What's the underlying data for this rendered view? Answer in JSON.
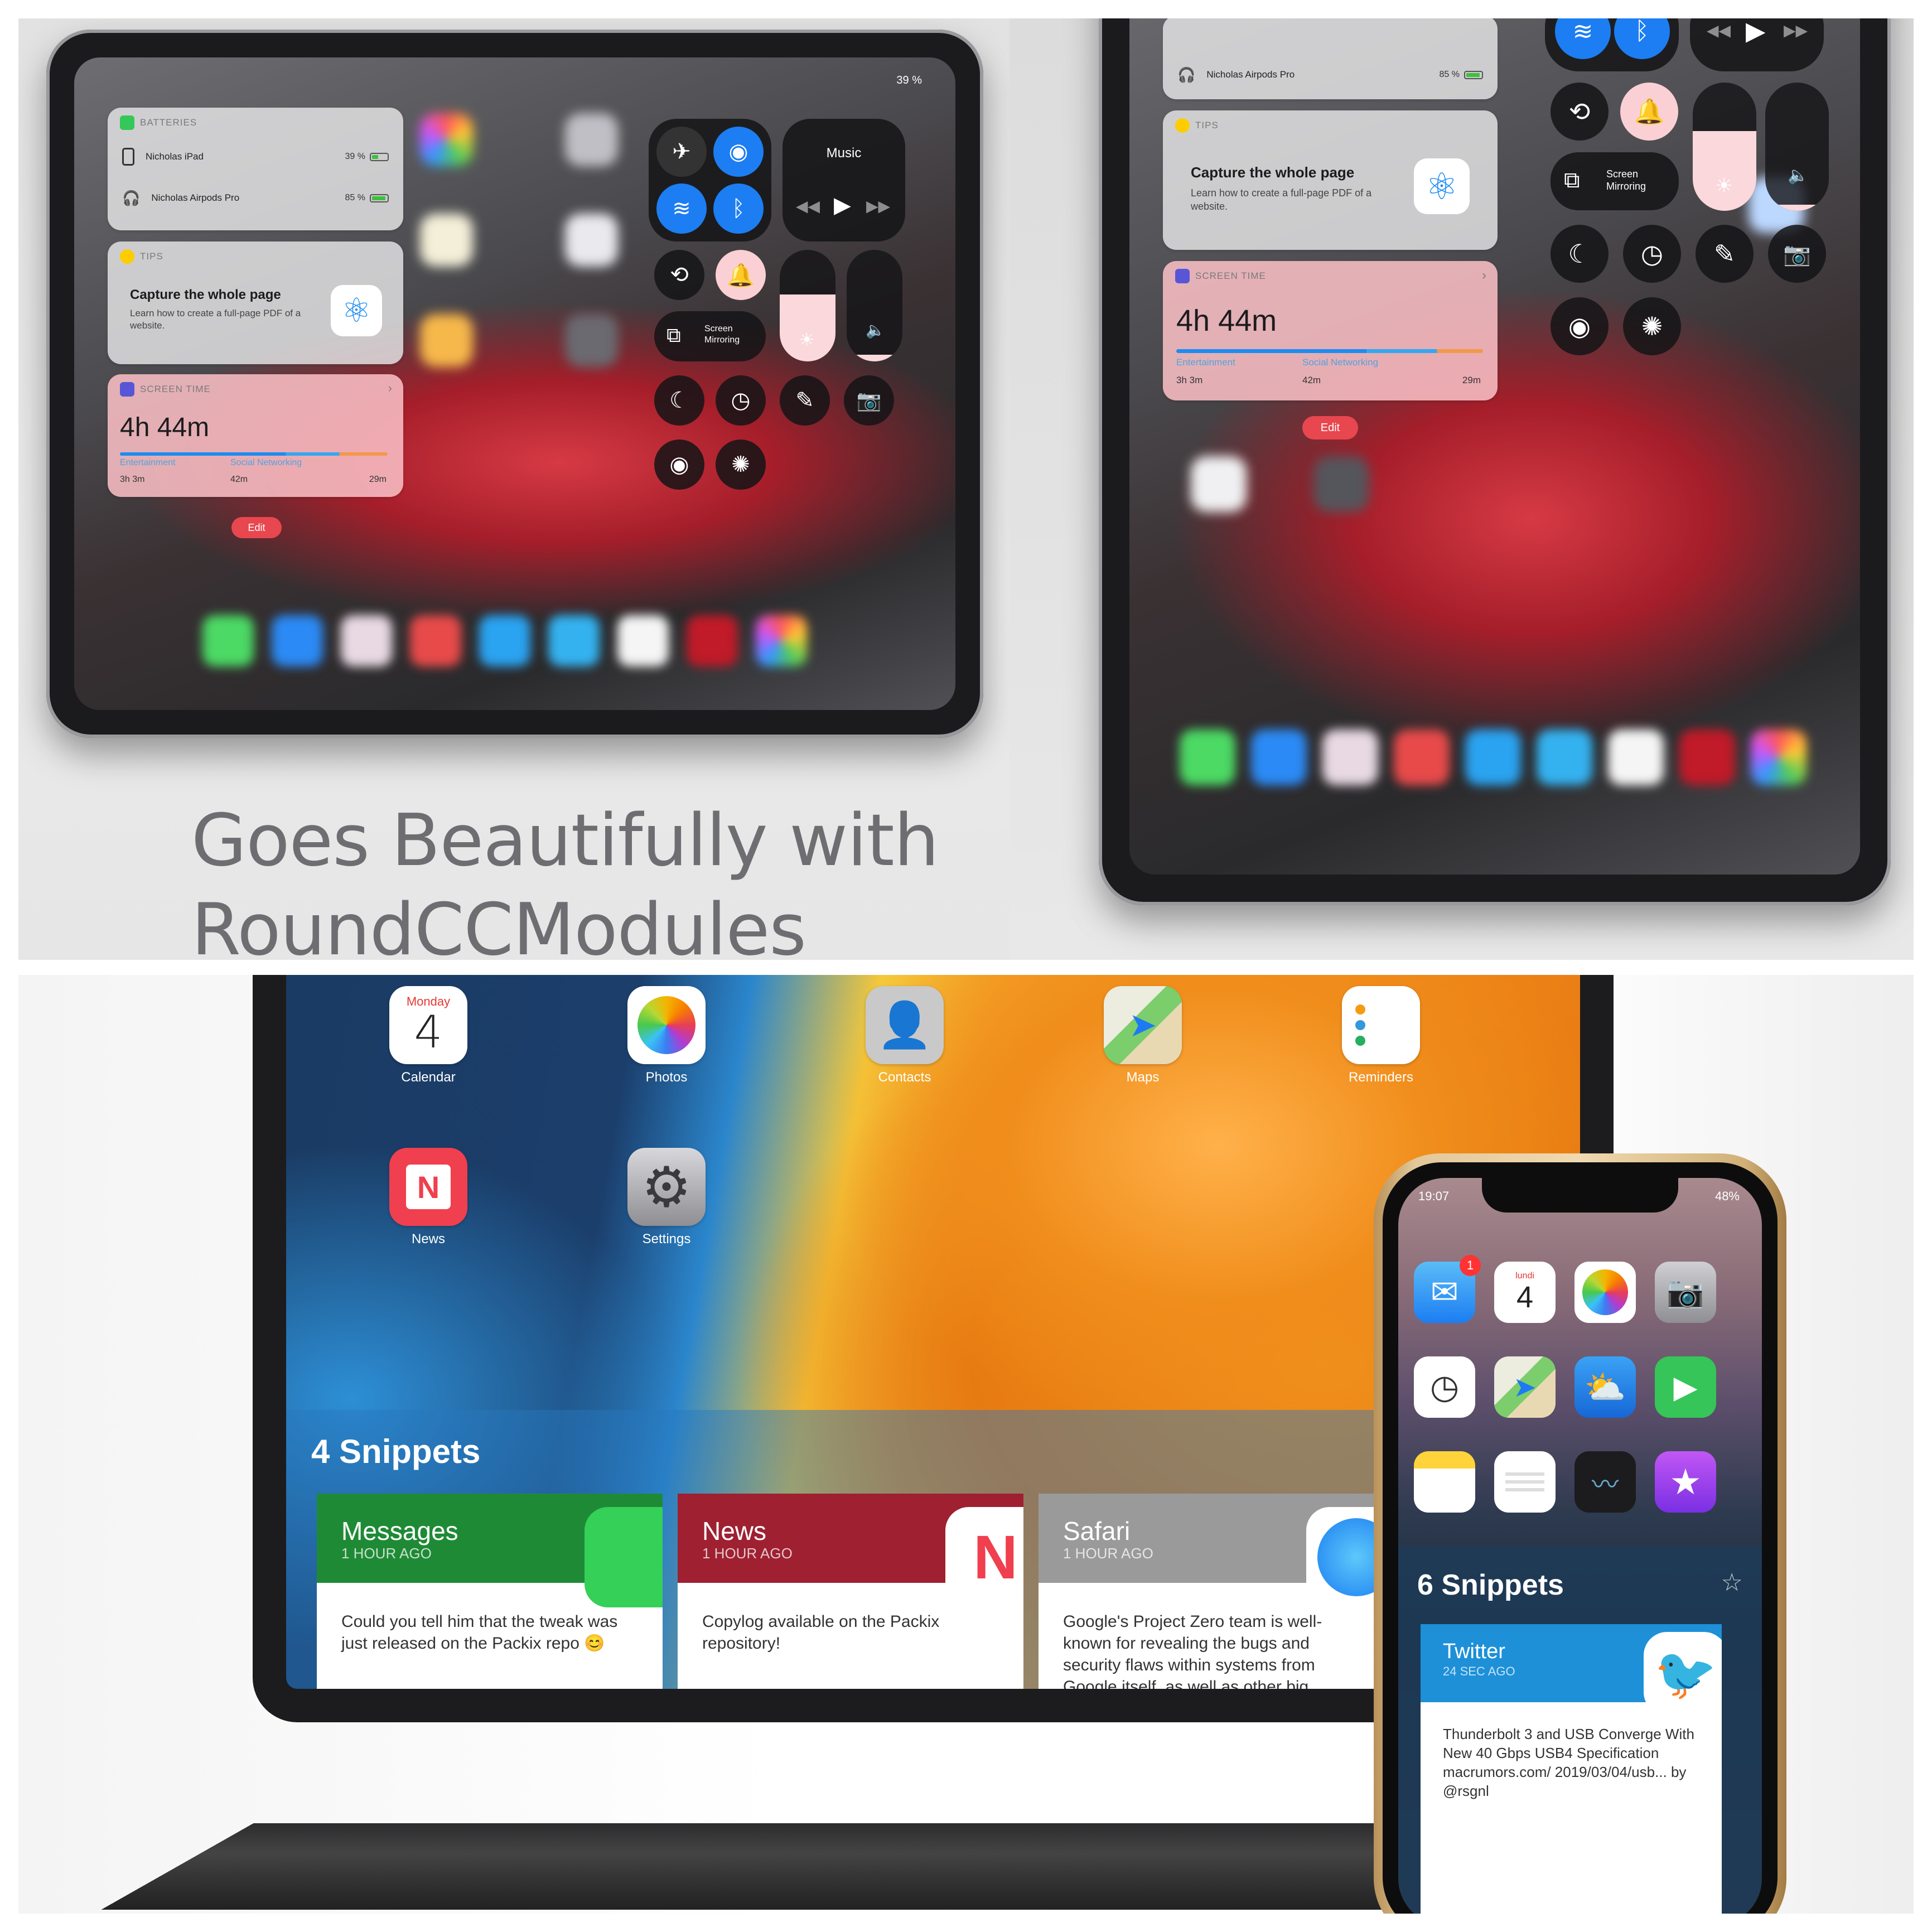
{
  "top_left": {
    "status": {
      "wifi_battery": "39 %"
    },
    "batteries_widget": {
      "header": "BATTERIES",
      "devices": [
        {
          "name": "Nicholas iPad",
          "percent": "39 %"
        },
        {
          "name": "Nicholas Airpods Pro",
          "percent": "85 %"
        }
      ]
    },
    "tips_widget": {
      "header": "TIPS",
      "title": "Capture the whole page",
      "body": "Learn how to create a full-page PDF of a website."
    },
    "screen_time_widget": {
      "header": "SCREEN TIME",
      "total": "4h 44m",
      "categories": [
        "Entertainment",
        "Social Networking"
      ],
      "values": [
        "3h 3m",
        "42m",
        "29m"
      ]
    },
    "edit_label": "Edit",
    "music_label": "Music",
    "screen_mirroring_label": "Screen Mirroring",
    "headline_line1": "Goes Beautifully with",
    "headline_line2": "RoundCCModules"
  },
  "top_right": {
    "airpods": {
      "name": "Nicholas Airpods Pro",
      "percent": "85 %"
    },
    "tips_widget": {
      "header": "TIPS",
      "title": "Capture the whole page",
      "body": "Learn how to create a full-page PDF of a website."
    },
    "screen_time_widget": {
      "header": "SCREEN TIME",
      "total": "4h 44m",
      "categories": [
        "Entertainment",
        "Social Networking"
      ],
      "values": [
        "3h 3m",
        "42m",
        "29m"
      ]
    },
    "edit_label": "Edit",
    "screen_mirroring_label": "Screen Mirroring"
  },
  "bottom": {
    "ipad_apps": [
      {
        "label": "Calendar",
        "day": "Monday",
        "date": "4"
      },
      {
        "label": "Photos"
      },
      {
        "label": "Contacts"
      },
      {
        "label": "Maps"
      },
      {
        "label": "Reminders"
      },
      {
        "label": "News"
      },
      {
        "label": "Settings"
      }
    ],
    "snippets_title": "4 Snippets",
    "cards": [
      {
        "app": "Messages",
        "time": "1 HOUR AGO",
        "body": "Could you tell him that the tweak was just released on the Packix repo 😊",
        "color": "#1f8a36"
      },
      {
        "app": "News",
        "time": "1 HOUR AGO",
        "body": "Copylog available on the Packix repository!",
        "color": "#9e2031"
      },
      {
        "app": "Safari",
        "time": "1 HOUR AGO",
        "body": "Google's Project Zero team is well-known for revealing the bugs and security flaws within systems from Google itself, as well as other big companies. Most recently, the team at Google has reported and publicly disclosed a \"high severity\" flaw in",
        "color": "#9a9a9a"
      }
    ],
    "iphone": {
      "time": "19:07",
      "battery": "48%",
      "calendar_day": "lundi",
      "calendar_date": "4",
      "badge": "1",
      "snippets_title": "6 Snippets",
      "card": {
        "app": "Twitter",
        "time": "24 SEC AGO",
        "body": "Thunderbolt 3 and USB Converge With New 40 Gbps USB4 Specification macrumors.com/ 2019/03/04/usb... by @rsgnl",
        "color": "#1d90d8"
      }
    }
  }
}
